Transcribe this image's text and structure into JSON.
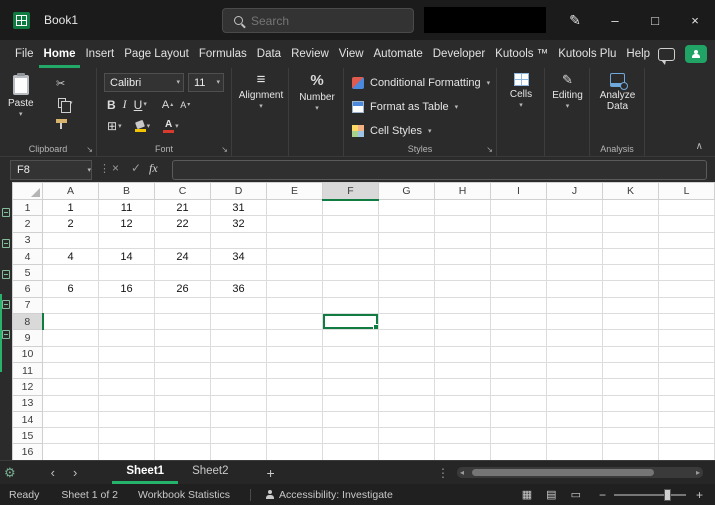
{
  "title_bar": {
    "title": "Book1",
    "search_placeholder": "Search"
  },
  "ribbon_tabs": {
    "active": "Home",
    "items": [
      "File",
      "Home",
      "Insert",
      "Page Layout",
      "Formulas",
      "Data",
      "Review",
      "View",
      "Automate",
      "Developer",
      "Kutools ™",
      "Kutools Plu",
      "Help"
    ]
  },
  "ribbon": {
    "clipboard": {
      "paste": "Paste",
      "label": "Clipboard"
    },
    "font": {
      "name": "Calibri",
      "size": "11",
      "bold": "B",
      "italic": "I",
      "underline": "U",
      "grow": "A",
      "shrink": "A",
      "color_letter": "A",
      "label": "Font"
    },
    "alignment": {
      "label": "Alignment"
    },
    "number": {
      "symbol": "%",
      "label": "Number"
    },
    "styles": {
      "items": [
        "Conditional Formatting",
        "Format as Table",
        "Cell Styles"
      ],
      "label": "Styles"
    },
    "cells": {
      "label": "Cells"
    },
    "editing": {
      "label": "Editing"
    },
    "analysis": {
      "button_line1": "Analyze",
      "button_line2": "Data",
      "label": "Analysis"
    }
  },
  "formula_bar": {
    "name_box": "F8",
    "fx": "fx",
    "value": ""
  },
  "grid": {
    "columns": [
      "A",
      "B",
      "C",
      "D",
      "E",
      "F",
      "G",
      "H",
      "I",
      "J",
      "K",
      "L"
    ],
    "row_count": 16,
    "selected": {
      "cell": "F8",
      "column": "F",
      "row": 8
    },
    "cells": {
      "A1": "1",
      "B1": "11",
      "C1": "21",
      "D1": "31",
      "A2": "2",
      "B2": "12",
      "C2": "22",
      "D2": "32",
      "A4": "4",
      "B4": "14",
      "C4": "24",
      "D4": "34",
      "A6": "6",
      "B6": "16",
      "C6": "26",
      "D6": "36"
    }
  },
  "sheet_bar": {
    "tabs": [
      {
        "label": "Sheet1",
        "active": true
      },
      {
        "label": "Sheet2",
        "active": false
      }
    ]
  },
  "status_bar": {
    "mode": "Ready",
    "sheet_info": "Sheet 1 of 2",
    "workbook_statistics": "Workbook Statistics",
    "accessibility": "Accessibility: Investigate"
  },
  "icons": {
    "dropdown": "▾",
    "cut": "✂",
    "borders": "⊞",
    "align": "≡",
    "pencil": "✎",
    "gear": "⚙",
    "check": "✓",
    "cancel": "×",
    "dots": "⋮",
    "prev": "‹",
    "next": "›",
    "left_arrow": "◂",
    "right_arrow": "▸",
    "add": "+",
    "more": "⋮",
    "minimize": "–",
    "maximize": "□",
    "close": "×",
    "collapse": "∧",
    "launcher": "↘",
    "pen": "✎",
    "view_normal": "▦",
    "view_layout": "▤",
    "view_break": "▭",
    "zoom_out": "−",
    "zoom_in": "+",
    "tiny_up": "▴",
    "tiny_down": "▾"
  }
}
